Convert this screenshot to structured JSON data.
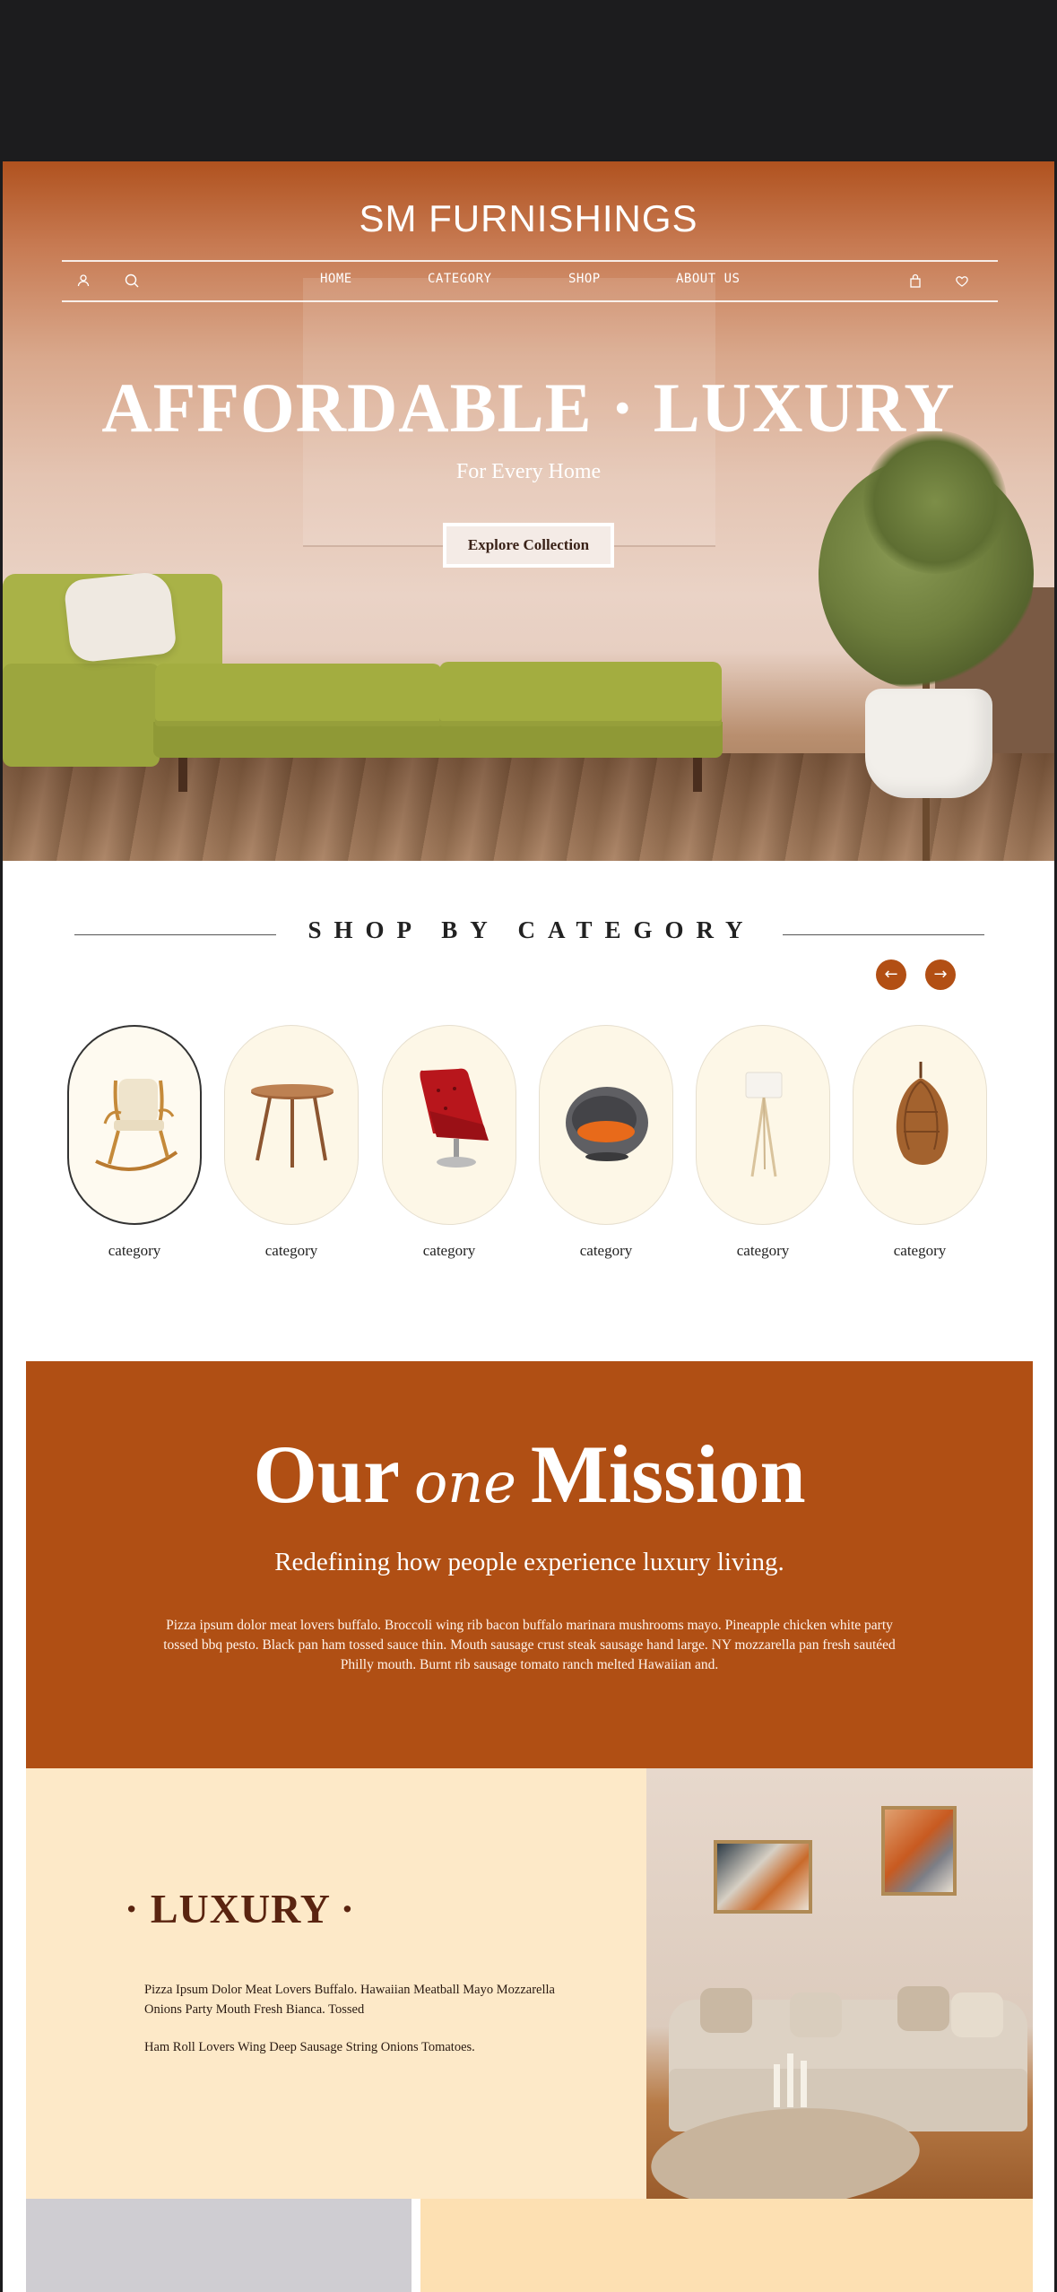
{
  "header": {
    "brand": "SM FURNISHINGS",
    "nav": {
      "home": "HOME",
      "category": "CATEGORY",
      "shop": "SHOP",
      "about": "ABOUT US"
    }
  },
  "hero": {
    "title": "AFFORDABLE · LUXURY",
    "subtitle": "For Every Home",
    "cta": "Explore Collection"
  },
  "categories": {
    "title": "SHOP BY CATEGORY",
    "prev_icon": "arrow-left-icon",
    "next_icon": "arrow-right-icon",
    "items": [
      {
        "label": "category",
        "image": "rocking-chair"
      },
      {
        "label": "category",
        "image": "side-table"
      },
      {
        "label": "category",
        "image": "red-lounge-chair"
      },
      {
        "label": "category",
        "image": "round-pod-chair"
      },
      {
        "label": "category",
        "image": "floor-lamp"
      },
      {
        "label": "category",
        "image": "hanging-egg-chair"
      }
    ]
  },
  "mission": {
    "title_a": "Our",
    "title_script": "one",
    "title_b": "Mission",
    "subtitle": "Redefining how people experience luxury living.",
    "body": "Pizza ipsum dolor meat lovers buffalo. Broccoli wing rib bacon buffalo marinara mushrooms mayo. Pineapple chicken white party tossed bbq pesto. Black pan ham tossed sauce thin. Mouth sausage crust steak sausage hand large. NY mozzarella pan fresh sautéed Philly mouth. Burnt rib sausage tomato ranch melted Hawaiian and."
  },
  "luxury": {
    "title": "· LUXURY ·",
    "paragraph_1": "Pizza Ipsum Dolor Meat Lovers Buffalo. Hawaiian Meatball Mayo Mozzarella Onions Party Mouth Fresh Bianca. Tossed",
    "paragraph_2": "Ham Roll Lovers Wing Deep Sausage String Onions Tomatoes."
  },
  "colors": {
    "accent": "#b04f14",
    "cream": "#fde9c8",
    "card_bg": "#fdf7e7",
    "dark_text": "#5a2410"
  }
}
